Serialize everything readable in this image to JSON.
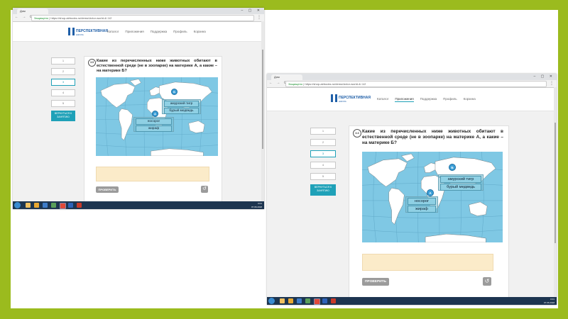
{
  "browser": {
    "tab_title": "Дом",
    "url_secure": "Защищено",
    "url": "https://shop-airbooks.ru/demo/victor-world-4/-1/2"
  },
  "site": {
    "logo_name": "ПЕРСПЕКТИВНАЯ",
    "logo_sub": "ШКОЛА",
    "nav": [
      "Каталог",
      "Приложения",
      "Поддержка",
      "Профиль",
      "Корзина"
    ]
  },
  "sidebar": {
    "questions": [
      "1",
      "2",
      "3",
      "4",
      "5"
    ],
    "current": "3",
    "back_label": "ВЕРНУТЬСЯ К ЗАНЯТИЮ"
  },
  "question": {
    "number": "3.5",
    "number_alt": "3.3",
    "text": "Какие из перечисленных ниже животных обитают в естественной среде (не в зоопарке) на материке А, а какие – на материке Б?"
  },
  "map": {
    "label_a": "А",
    "label_b": "Б",
    "zone_b": [
      "амурский тигр",
      "бурый медведь"
    ],
    "zone_a": [
      "носорог",
      "жираф"
    ],
    "ocean_color": "#7fc8e4",
    "land_color": "#ffffff"
  },
  "buttons": {
    "check": "ПРОВЕРИТЬ",
    "reset_icon": "reset-icon"
  },
  "taskbar": {
    "time": "0:01",
    "date": "07.06.2018"
  },
  "colors": {
    "slide_bg": "#9bbb1e",
    "accent": "#1fa1b8",
    "answer_bg": "#fbebc9"
  }
}
